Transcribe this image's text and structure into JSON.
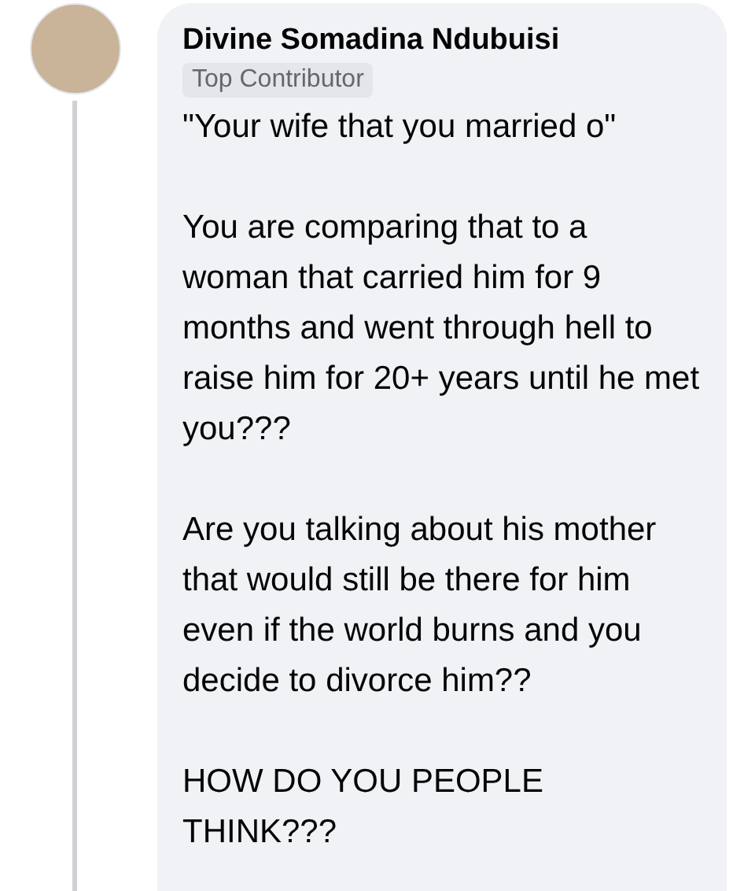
{
  "comment": {
    "author": "Divine Somadina Ndubuisi",
    "badge": "Top Contributor",
    "paragraphs": [
      "\"Your wife that you married o\"",
      "You are comparing that to a woman that carried him for 9 months and went through hell to raise him for 20+ years until he met you???",
      "Are you talking about his mother that would still be there for him even if the world burns and you decide to divorce him??",
      "HOW DO YOU PEOPLE THINK???"
    ]
  }
}
